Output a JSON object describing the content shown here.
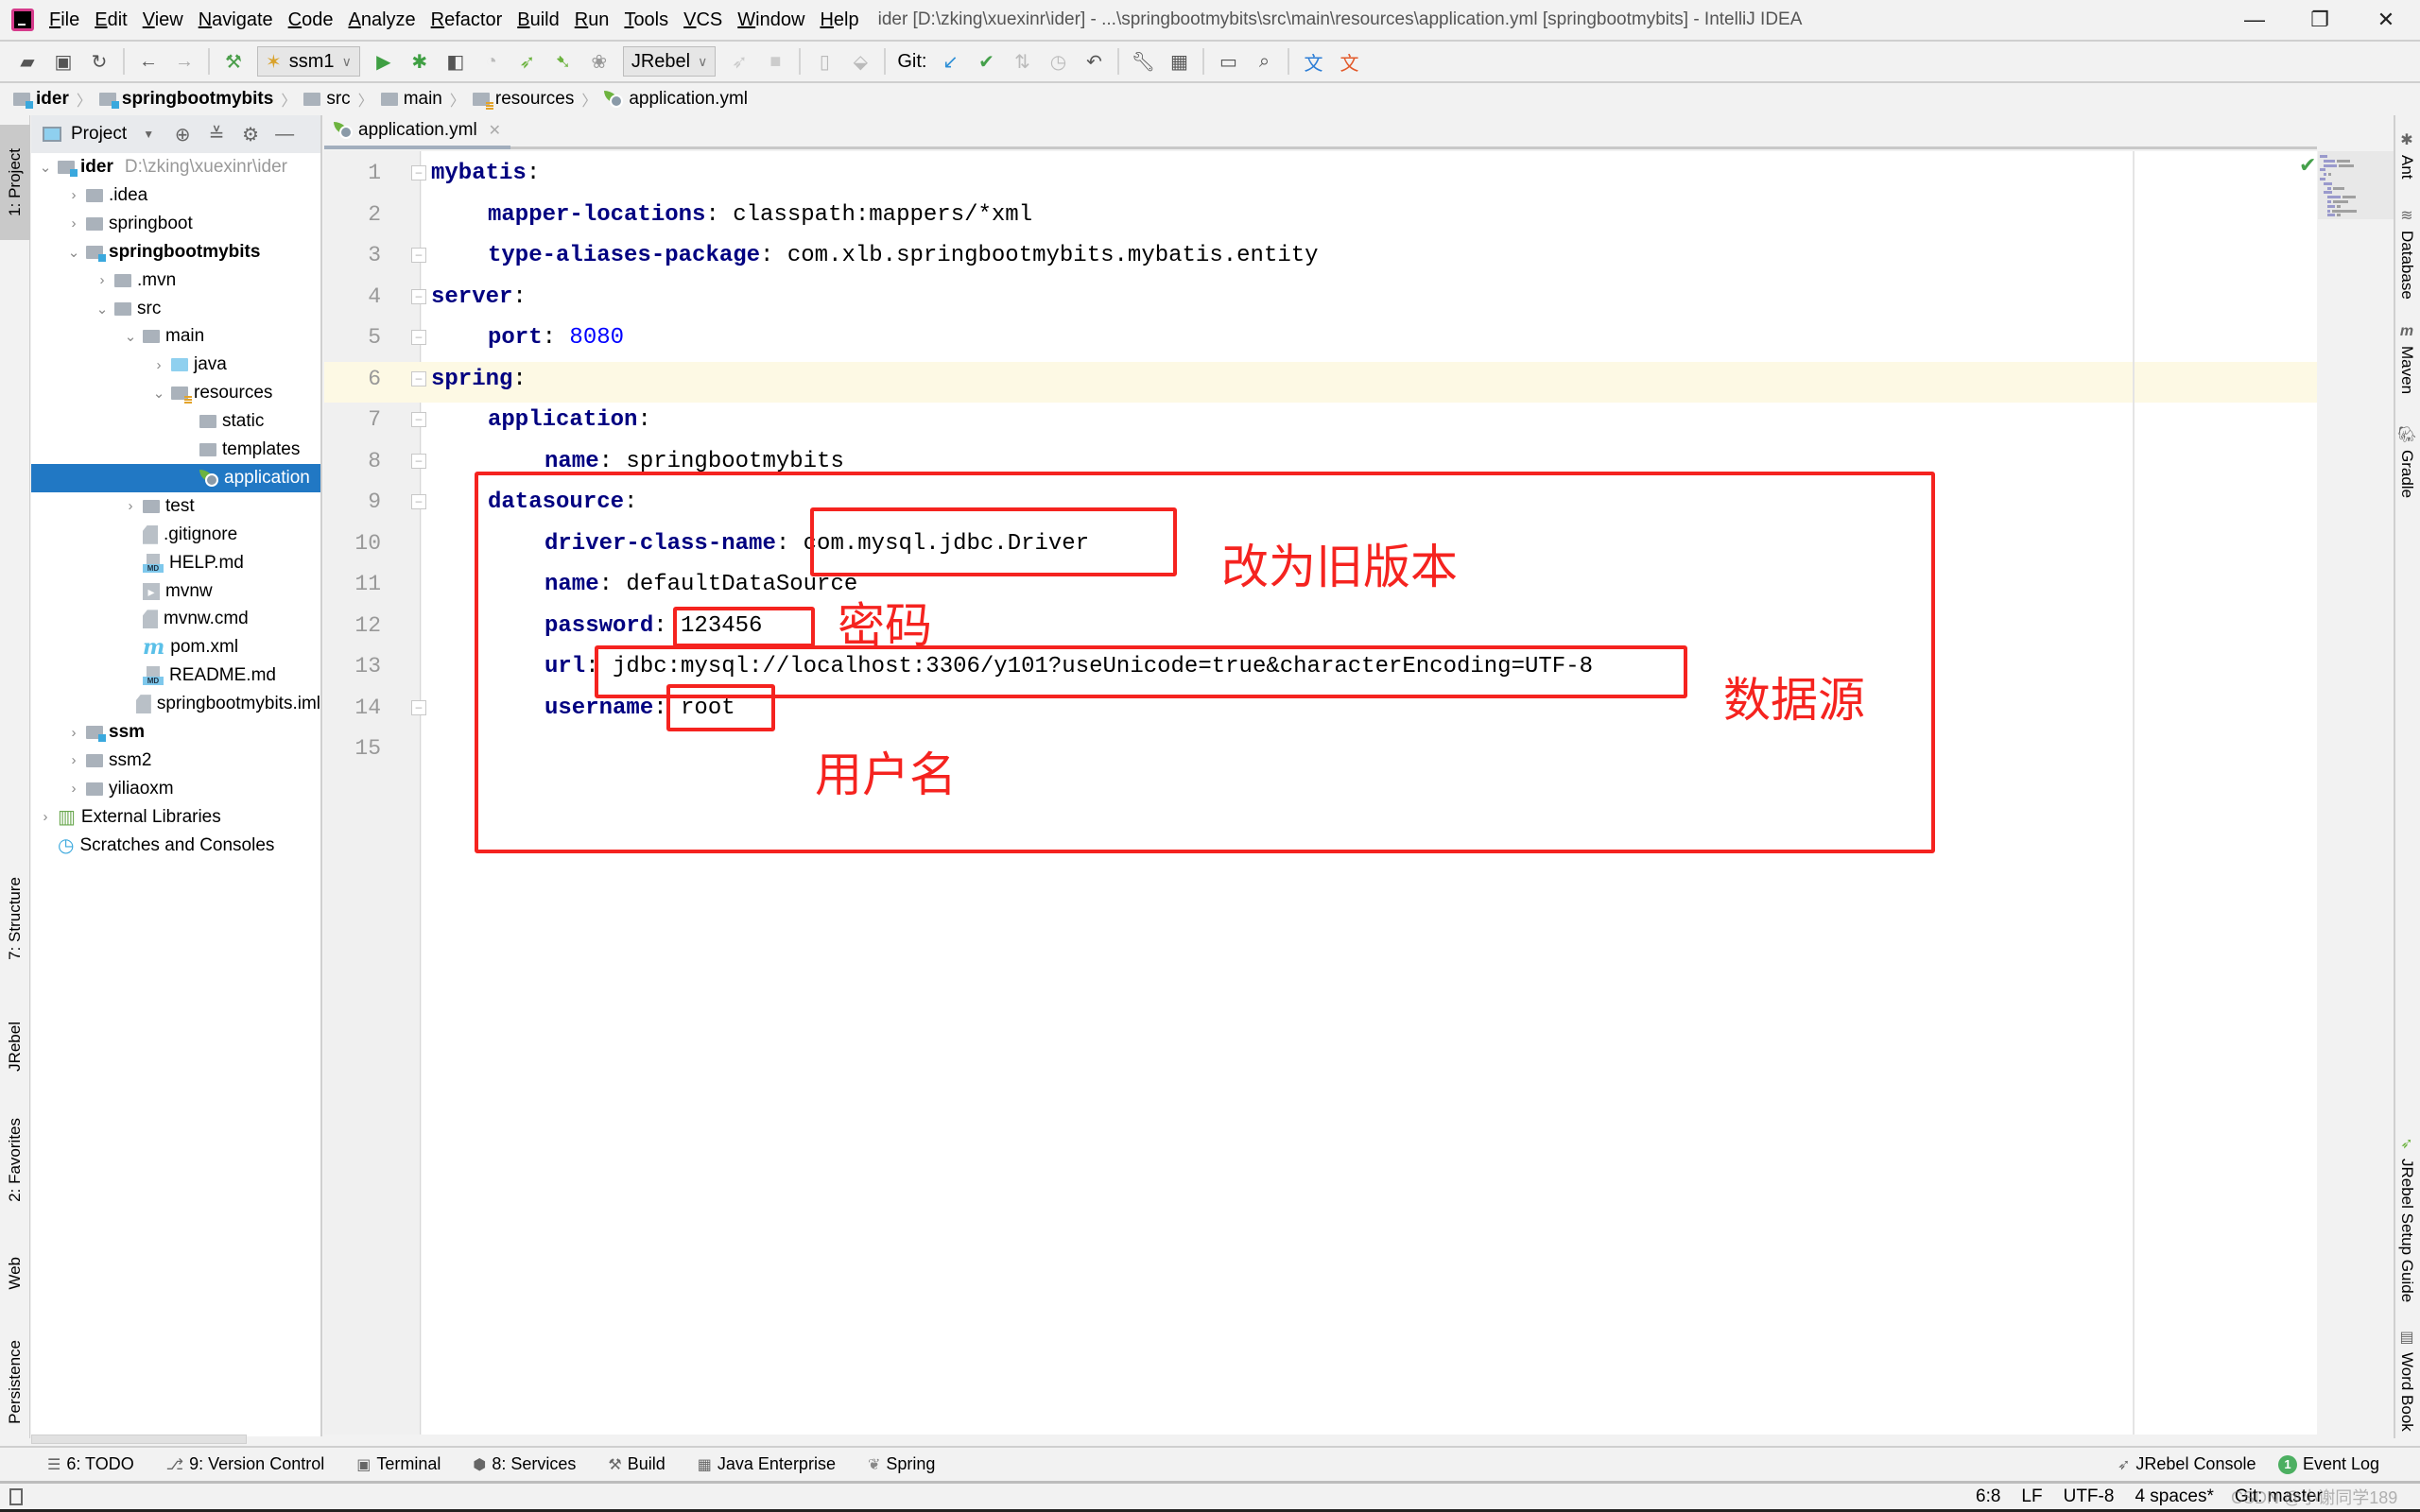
{
  "titlebar": {
    "menu": [
      "File",
      "Edit",
      "View",
      "Navigate",
      "Code",
      "Analyze",
      "Refactor",
      "Build",
      "Run",
      "Tools",
      "VCS",
      "Window",
      "Help"
    ],
    "window_title": "ider [D:\\zking\\xuexinr\\ider] - ...\\springbootmybits\\src\\main\\resources\\application.yml [springbootmybits] - IntelliJ IDEA",
    "minimize": "—",
    "maximize": "❐",
    "close": "✕"
  },
  "toolbar": {
    "run_config": "ssm1",
    "jrebel_combo": "JRebel",
    "git_label": "Git:"
  },
  "breadcrumb": [
    "ider",
    "springbootmybits",
    "src",
    "main",
    "resources",
    "application.yml"
  ],
  "left_stripe": [
    "1: Project",
    "7: Structure",
    "JRebel",
    "2: Favorites",
    "Web",
    "Persistence"
  ],
  "project_panel": {
    "title": "Project",
    "tree": [
      {
        "label": "ider",
        "path": "D:\\zking\\xuexinr\\ider"
      },
      {
        "label": ".idea"
      },
      {
        "label": "springboot"
      },
      {
        "label": "springbootmybits"
      },
      {
        "label": ".mvn"
      },
      {
        "label": "src"
      },
      {
        "label": "main"
      },
      {
        "label": "java"
      },
      {
        "label": "resources"
      },
      {
        "label": "static"
      },
      {
        "label": "templates"
      },
      {
        "label": "application"
      },
      {
        "label": "test"
      },
      {
        "label": ".gitignore"
      },
      {
        "label": "HELP.md"
      },
      {
        "label": "mvnw"
      },
      {
        "label": "mvnw.cmd"
      },
      {
        "label": "pom.xml"
      },
      {
        "label": "README.md"
      },
      {
        "label": "springbootmybits.iml"
      },
      {
        "label": "ssm"
      },
      {
        "label": "ssm2"
      },
      {
        "label": "yiliaoxm"
      },
      {
        "label": "External Libraries"
      },
      {
        "label": "Scratches and Consoles"
      }
    ]
  },
  "editor": {
    "tab_label": "application.yml",
    "lines": [
      {
        "num": "1",
        "key": "mybatis",
        "val": ""
      },
      {
        "num": "2",
        "key": "mapper-locations",
        "val": "classpath:mappers/*xml"
      },
      {
        "num": "3",
        "key": "type-aliases-package",
        "val": "com.xlb.springbootmybits.mybatis.entity"
      },
      {
        "num": "4",
        "key": "server",
        "val": ""
      },
      {
        "num": "5",
        "key": "port",
        "val": "8080"
      },
      {
        "num": "6",
        "key": "spring",
        "val": ""
      },
      {
        "num": "7",
        "key": "application",
        "val": ""
      },
      {
        "num": "8",
        "key": "name",
        "val": "springbootmybits"
      },
      {
        "num": "9",
        "key": "datasource",
        "val": ""
      },
      {
        "num": "10",
        "key": "driver-class-name",
        "val": "com.mysql.jdbc.Driver"
      },
      {
        "num": "11",
        "key": "name",
        "val": "defaultDataSource"
      },
      {
        "num": "12",
        "key": "password",
        "val": "123456"
      },
      {
        "num": "13",
        "key": "url",
        "val": "jdbc:mysql://localhost:3306/y101?useUnicode=true&characterEncoding=UTF-8"
      },
      {
        "num": "14",
        "key": "username",
        "val": "root"
      },
      {
        "num": "15",
        "key": "",
        "val": ""
      }
    ]
  },
  "annotations": {
    "driver": "改为旧版本",
    "password": "密码",
    "datasource": "数据源",
    "username": "用户名",
    "color": "#f5231f"
  },
  "right_stripe": [
    "Ant",
    "Database",
    "Maven",
    "Gradle",
    "JRebel Setup Guide",
    "Word Book"
  ],
  "bottom_tools": {
    "todo": "6: TODO",
    "vcs": "9: Version Control",
    "terminal": "Terminal",
    "services": "8: Services",
    "build": "Build",
    "java_ee": "Java Enterprise",
    "spring": "Spring",
    "jrebel_console": "JRebel Console",
    "event_log": "Event Log",
    "event_count": "1"
  },
  "status": {
    "position": "6:8",
    "line_sep": "LF",
    "encoding": "UTF-8",
    "indent": "4 spaces*",
    "git": "Git: master",
    "watermark": "CSDN @小谢同学189"
  }
}
